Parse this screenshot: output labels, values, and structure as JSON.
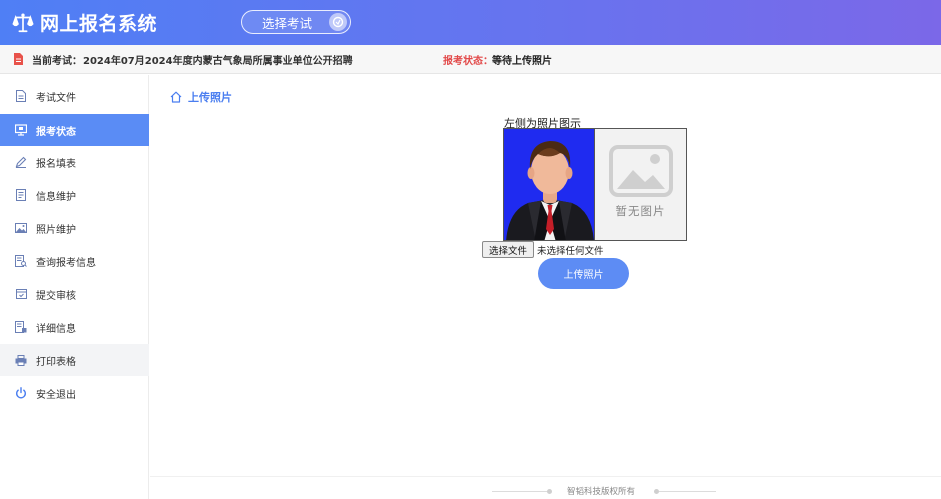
{
  "header": {
    "title": "网上报名系统",
    "select_exam_label": "选择考试"
  },
  "infobar": {
    "current_exam_label": "当前考试：",
    "current_exam_value": "2024年07月2024年度内蒙古气象局所属事业单位公开招聘",
    "status_label": "报考状态：",
    "status_value": "等待上传照片"
  },
  "sidebar": {
    "items": [
      {
        "label": "考试文件",
        "icon": "document-icon"
      },
      {
        "label": "报考状态",
        "icon": "monitor-icon",
        "active": true
      },
      {
        "label": "报名填表",
        "icon": "pencil-icon"
      },
      {
        "label": "信息维护",
        "icon": "file-list-icon"
      },
      {
        "label": "照片维护",
        "icon": "image-icon"
      },
      {
        "label": "查询报考信息",
        "icon": "search-doc-icon"
      },
      {
        "label": "提交审核",
        "icon": "submit-icon"
      },
      {
        "label": "详细信息",
        "icon": "detail-doc-icon"
      },
      {
        "label": "打印表格",
        "icon": "printer-icon"
      },
      {
        "label": "安全退出",
        "icon": "power-icon"
      }
    ]
  },
  "main": {
    "breadcrumb": "上传照片",
    "photo_caption": "左侧为照片图示",
    "placeholder_text": "暂无图片",
    "file_button_label": "选择文件",
    "file_status": "未选择任何文件",
    "upload_button_label": "上传照片"
  },
  "footer": {
    "text": "智韬科技版权所有"
  },
  "colors": {
    "accent": "#5a8cf5",
    "status_red": "#e24a4a",
    "header_start": "#4f7ff5",
    "header_end": "#7b68e8"
  }
}
